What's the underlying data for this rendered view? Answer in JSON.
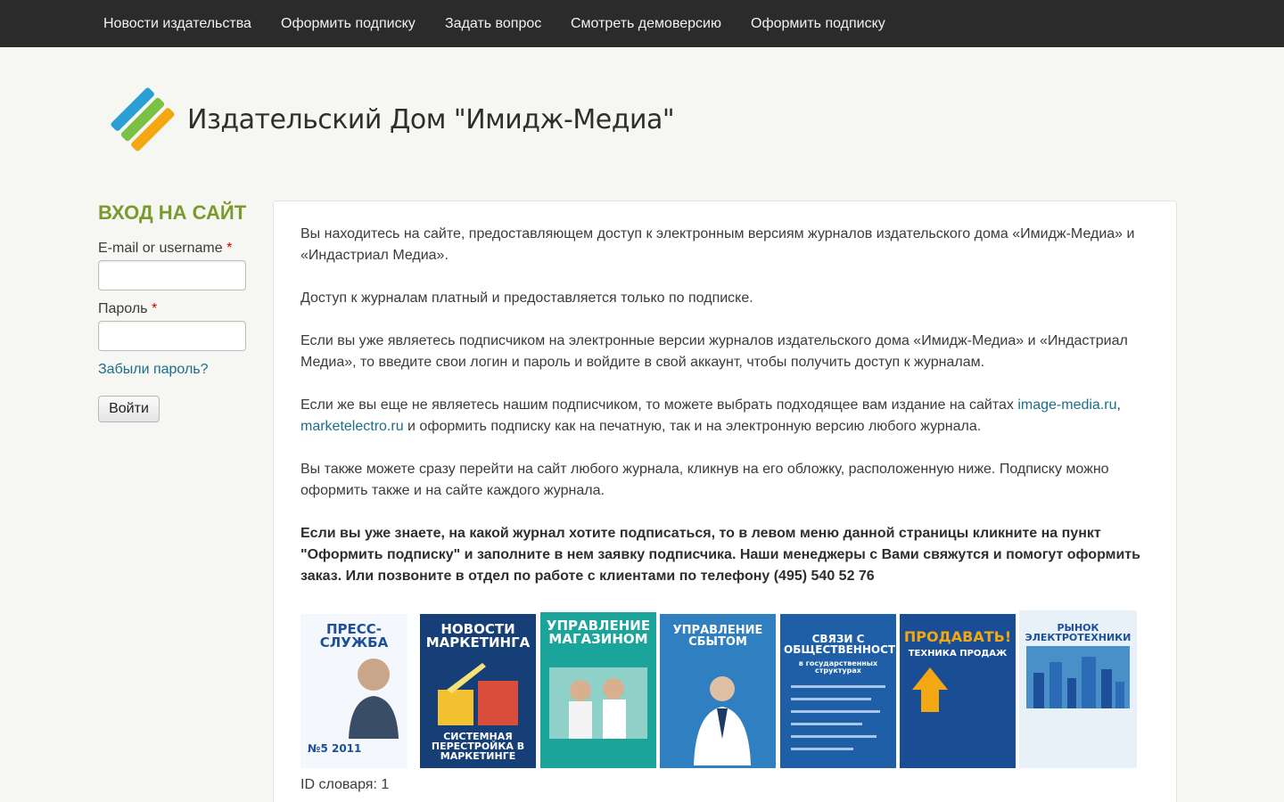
{
  "nav": {
    "items": [
      {
        "label": "Новости издательства"
      },
      {
        "label": "Оформить подписку"
      },
      {
        "label": "Задать вопрос"
      },
      {
        "label": "Смотреть демоверсию"
      },
      {
        "label": "Оформить подписку"
      }
    ]
  },
  "header": {
    "site_name": "Издательский Дом \"Имидж-Медиа\"",
    "logo_colors": [
      "#2a9fd6",
      "#7bc143",
      "#f3a712"
    ]
  },
  "login": {
    "title": "ВХОД НА САЙТ",
    "username_label": "E-mail or username",
    "password_label": "Пароль",
    "required_mark": "*",
    "forgot_link": "Забыли пароль?",
    "submit_label": "Войти"
  },
  "content": {
    "p1": "Вы находитесь на сайте, предоставляющем доступ к электронным версиям журналов издательского дома «Имидж-Медиа» и «Индастриал Медиа».",
    "p2": "Доступ к журналам платный и предоставляется только по подписке.",
    "p3": "Если вы уже являетесь подписчиком на электронные версии журналов издательского дома «Имидж-Медиа» и «Индастриал Медиа», то введите свои логин и пароль и войдите в свой аккаунт, чтобы получить доступ к журналам.",
    "p4_start": "Если же вы еще не являетесь нашим подписчиком, то можете выбрать подходящее вам издание на сайтах ",
    "p4_link1": "image-media.ru",
    "p4_sep": ", ",
    "p4_link2": "marketelectro.ru",
    "p4_end": " и оформить подписку как на печатную, так и на электронную версию любого журнала.",
    "p5": "Вы также можете сразу перейти на сайт любого журнала, кликнув на его обложку, расположенную ниже. Подписку можно оформить также и на сайте каждого журнала.",
    "p6": "Если вы уже знаете, на какой журнал хотите подписаться, то в левом меню данной страницы кликните на пункт \"Оформить подписку\" и заполните в нем заявку подписчика. Наши менеджеры с Вами свяжутся и помогут оформить заказ. Или позвоните в отдел по работе с клиентами по телефону (495) 540 52 76",
    "dict_id": "ID словаря: 1"
  },
  "covers": [
    {
      "title": "ПРЕСС-СЛУЖБА",
      "subtitle": "№5 2011",
      "bg": "#f4f7fb",
      "fg": "#1d4f9a"
    },
    {
      "title": "НОВОСТИ МАРКЕТИНГА",
      "subtitle": "СИСТЕМНАЯ ПЕРЕСТРОЙКА В МАРКЕТИНГЕ",
      "bg": "#173f77",
      "fg": "#ffffff"
    },
    {
      "title": "УПРАВЛЕНИЕ МАГАЗИНОМ",
      "subtitle": "",
      "bg": "#1ba59a",
      "fg": "#ffffff"
    },
    {
      "title": "УПРАВЛЕНИЕ СБЫТОМ",
      "subtitle": "",
      "bg": "#2f7fc1",
      "fg": "#ffffff"
    },
    {
      "title": "СВЯЗИ С ОБЩЕСТВЕННОСТЬЮ",
      "subtitle": "в государственных структурах",
      "bg": "#1f5fa8",
      "fg": "#ffffff"
    },
    {
      "title": "ПРОДАВАТЬ!",
      "subtitle": "ТЕХНИКА ПРОДАЖ",
      "bg": "#1a4e94",
      "fg": "#ffffff"
    },
    {
      "title": "РЫНОК ЭЛЕКТРОТЕХНИКИ",
      "subtitle": "",
      "bg": "#e9f1f8",
      "fg": "#1d4f9a"
    }
  ]
}
